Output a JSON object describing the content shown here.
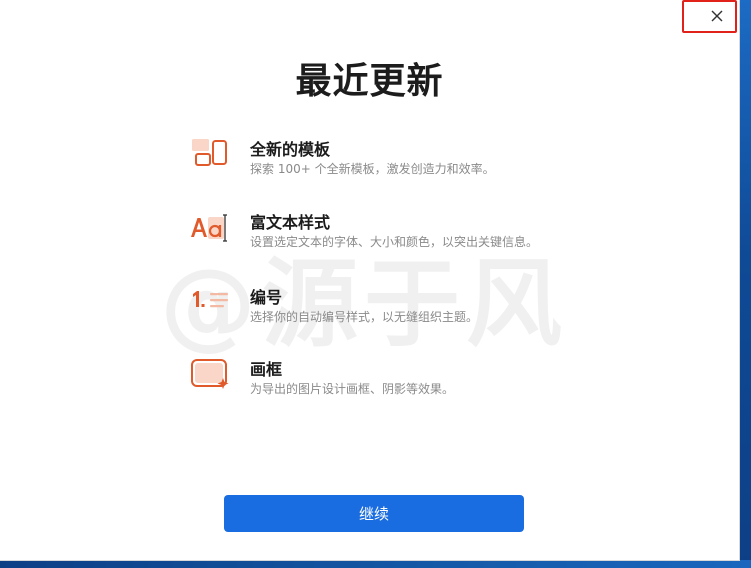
{
  "dialog": {
    "title": "最近更新",
    "close_icon": "close-icon",
    "watermark": "@源于风",
    "features": [
      {
        "icon": "template-icon",
        "name": "全新的模板",
        "desc": "探索 100+ 个全新模板，激发创造力和效率。"
      },
      {
        "icon": "rich-text-icon",
        "name": "富文本样式",
        "desc": "设置选定文本的字体、大小和颜色，以突出关键信息。"
      },
      {
        "icon": "numbering-icon",
        "name": "编号",
        "desc": "选择你的自动编号样式，以无缝组织主题。"
      },
      {
        "icon": "frame-icon",
        "name": "画框",
        "desc": "为导出的图片设计画框、阴影等效果。"
      }
    ],
    "continue_label": "继续"
  },
  "colors": {
    "accent": "#1a6de0",
    "icon_orange": "#e05a2b",
    "icon_peach": "#f9d6c8",
    "highlight_border": "#e0221b"
  }
}
